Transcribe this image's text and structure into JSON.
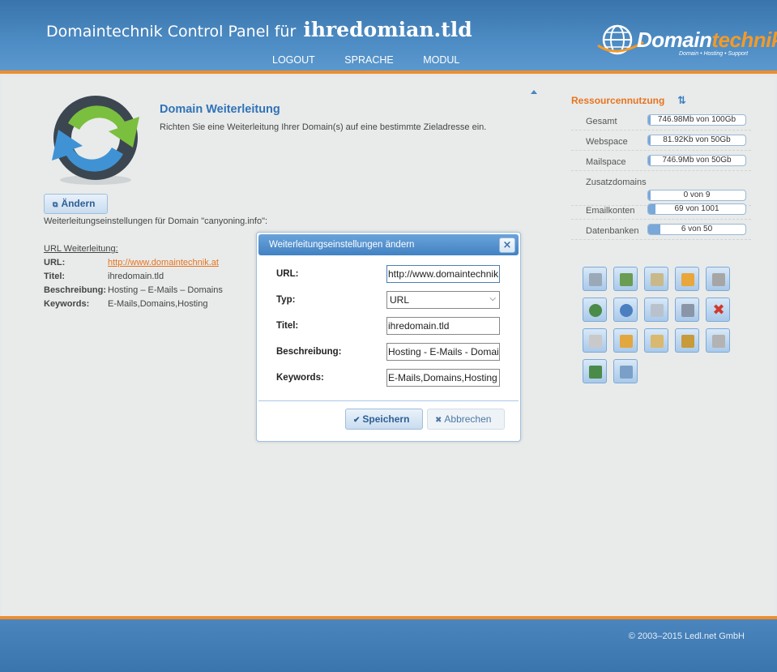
{
  "header": {
    "title_prefix": "Domaintechnik Control Panel für",
    "title_domain": "ihredomian.tld",
    "nav": [
      "LOGOUT",
      "SPRACHE",
      "MODUL"
    ],
    "logo_word_a": "Domain",
    "logo_word_b": "technik",
    "logo_tagline": "Domain  •  Hosting  •  Support"
  },
  "section": {
    "title": "Domain Weiterleitung",
    "description": "Richten Sie eine Weiterleitung Ihrer Domain(s) auf eine bestimmte Zieladresse ein.",
    "edit_button": "Ändern",
    "settings_for": "Weiterleitungseinstellungen für Domain \"canyoning.info\":",
    "url_heading": "URL Weiterleitung:",
    "fields": [
      {
        "key": "URL:",
        "value": "http://www.domaintechnik.at",
        "link": true
      },
      {
        "key": "Titel:",
        "value": "ihredomain.tld"
      },
      {
        "key": "Beschreibung:",
        "value": "Hosting – E-Mails – Domains"
      },
      {
        "key": "Keywords:",
        "value": "E-Mails,Domains,Hosting"
      }
    ]
  },
  "resources": {
    "title": "Ressourcennutzung",
    "rows": [
      {
        "label": "Gesamt",
        "value": "746.98Mb von 100Gb",
        "fill": 0.01
      },
      {
        "label": "Webspace",
        "value": "81.92Kb von 50Gb",
        "fill": 0.01
      },
      {
        "label": "Mailspace",
        "value": "746.9Mb von 50Gb",
        "fill": 0.02
      },
      {
        "label": "Zusatzdomains",
        "value": ""
      },
      {
        "label": "",
        "value": "0 von 9",
        "fill": 0.0
      },
      {
        "label": "Emailkonten",
        "value": "69 von 1001",
        "fill": 0.07
      },
      {
        "label": "Datenbanken",
        "value": "6 von 50",
        "fill": 0.12
      }
    ]
  },
  "tools": [
    {
      "name": "server-icon",
      "color": "#9aa8b8"
    },
    {
      "name": "user-search-icon",
      "color": "#6a9c52"
    },
    {
      "name": "document-icon",
      "color": "#c9b98a"
    },
    {
      "name": "folder-icon",
      "color": "#e9a63a"
    },
    {
      "name": "database-icon",
      "color": "#a6a6a6"
    },
    {
      "name": "redirect-icon",
      "color": "#4a8b4a"
    },
    {
      "name": "globe-icon",
      "color": "#4b7fc0"
    },
    {
      "name": "mail-icon",
      "color": "#b9c2cc"
    },
    {
      "name": "settings-icon",
      "color": "#8a96a8"
    },
    {
      "name": "delete-icon",
      "color": "#d03a2a"
    },
    {
      "name": "notes-icon",
      "color": "#c9c9c9"
    },
    {
      "name": "mail-folder-icon",
      "color": "#e2a73f"
    },
    {
      "name": "archive-icon",
      "color": "#d9b870"
    },
    {
      "name": "lock-icon",
      "color": "#c79a3a"
    },
    {
      "name": "package-icon",
      "color": "#b3b3b3"
    },
    {
      "name": "statistics-icon",
      "color": "#4a8b4a"
    },
    {
      "name": "transfer-icon",
      "color": "#7aa0c8"
    }
  ],
  "dialog": {
    "title": "Weiterleitungseinstellungen ändern",
    "close": "×",
    "fields": [
      {
        "label": "URL:",
        "value": "http://www.domaintechnik.at"
      },
      {
        "label": "Typ:",
        "value": "URL"
      },
      {
        "label": "Titel:",
        "value": "ihredomain.tld"
      },
      {
        "label": "Beschreibung:",
        "value": "Hosting - E-Mails - Domains"
      },
      {
        "label": "Keywords:",
        "value": "E-Mails,Domains,Hosting"
      }
    ],
    "save_label": "Speichern",
    "cancel_label": "Abbrechen"
  },
  "footer": {
    "copyright": "© 2003–2015 Ledl.net GmbH"
  }
}
